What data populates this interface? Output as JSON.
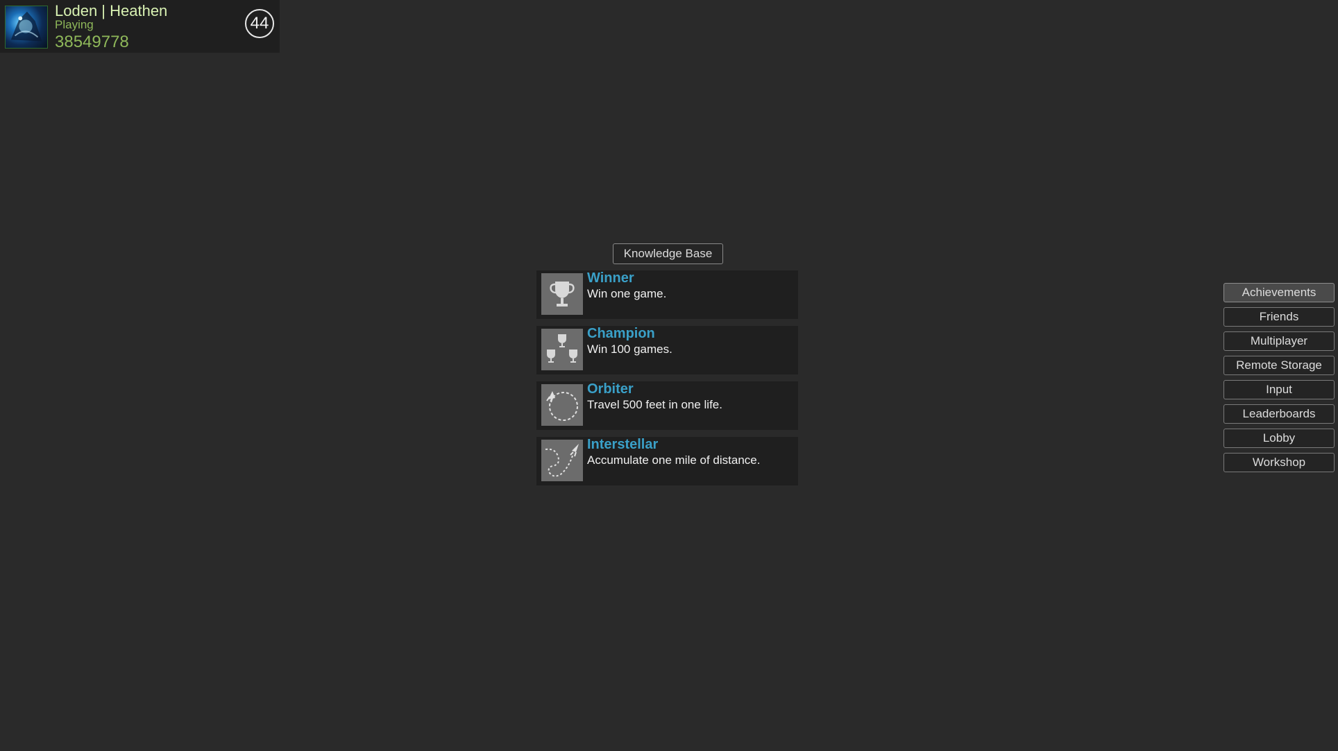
{
  "player": {
    "name": "Loden | Heathen",
    "status": "Playing",
    "id": "38549778",
    "level": "44",
    "avatar_icon": "avatar-image"
  },
  "knowledge_base_label": "Knowledge Base",
  "achievements": [
    {
      "title": "Winner",
      "description": "Win one game.",
      "icon": "trophy-icon"
    },
    {
      "title": "Champion",
      "description": "Win 100 games.",
      "icon": "three-trophies-icon"
    },
    {
      "title": "Orbiter",
      "description": "Travel 500 feet in one life.",
      "icon": "rocket-orbit-icon"
    },
    {
      "title": "Interstellar",
      "description": "Accumulate one mile of distance.",
      "icon": "rocket-path-icon"
    }
  ],
  "menu": {
    "items": [
      {
        "label": "Achievements",
        "active": true
      },
      {
        "label": "Friends"
      },
      {
        "label": "Multiplayer"
      },
      {
        "label": "Remote Storage"
      },
      {
        "label": "Input"
      },
      {
        "label": "Leaderboards"
      },
      {
        "label": "Lobby"
      },
      {
        "label": "Workshop"
      }
    ]
  },
  "colors": {
    "background": "#2a2a2a",
    "panel": "#1f1f1f",
    "achievement_title": "#3aa0c8",
    "player_green": "#8fb85a"
  }
}
